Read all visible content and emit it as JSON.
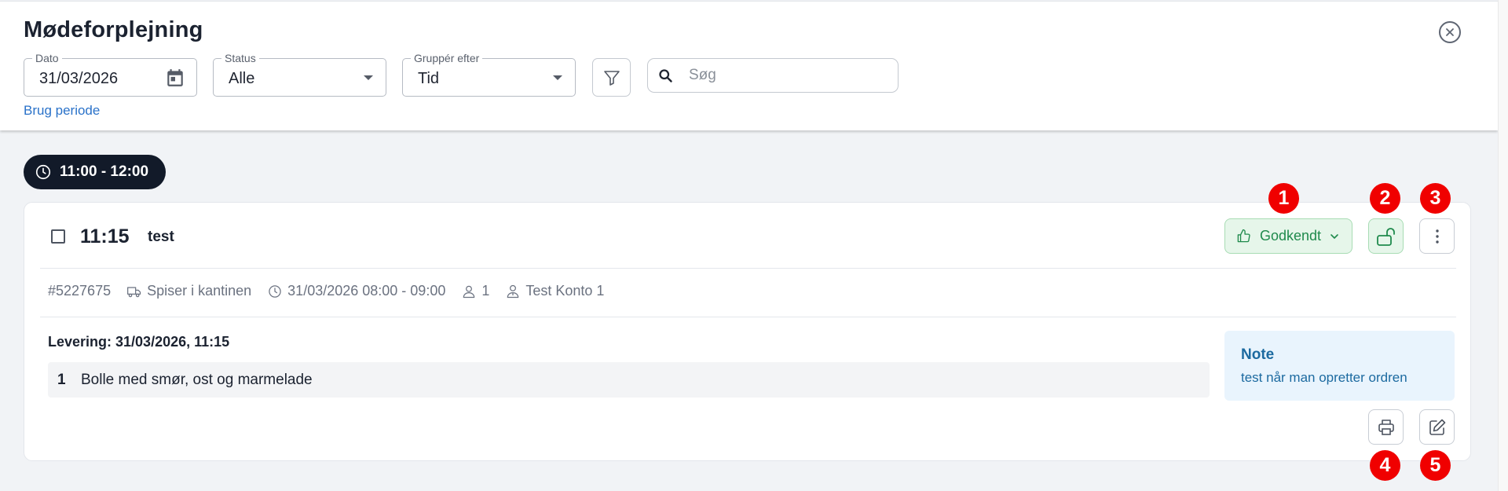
{
  "header": {
    "title": "Mødeforplejning",
    "date": {
      "label": "Dato",
      "value": "31/03/2026"
    },
    "status": {
      "label": "Status",
      "value": "Alle"
    },
    "group_by": {
      "label": "Gruppér efter",
      "value": "Tid"
    },
    "search": {
      "placeholder": "Søg"
    },
    "period_link": "Brug periode"
  },
  "time_group": {
    "label": "11:00 - 12:00"
  },
  "order": {
    "time": "11:15",
    "name": "test",
    "status_label": "Godkendt",
    "id": "#5227675",
    "location": "Spiser i kantinen",
    "datetime": "31/03/2026 08:00 - 09:00",
    "persons": "1",
    "account": "Test Konto 1",
    "delivery": "Levering: 31/03/2026, 11:15",
    "items": [
      {
        "qty": "1",
        "name": "Bolle med smør, ost og marmelade"
      }
    ],
    "note": {
      "title": "Note",
      "text": "test når man opretter ordren"
    }
  },
  "markers": [
    "1",
    "2",
    "3",
    "4",
    "5"
  ],
  "colors": {
    "approved_bg": "#e6f6ea",
    "approved_text": "#1f8a4c",
    "link": "#2a72c9",
    "note_text": "#1c6aa0",
    "pill_bg": "#121a29",
    "marker": "#f00000"
  },
  "icons": [
    "close-icon",
    "calendar-icon",
    "filter-icon",
    "search-icon",
    "clock-icon",
    "thumbs-up-icon",
    "chevron-down-icon",
    "unlock-icon",
    "more-vertical-icon",
    "truck-icon",
    "person-icon",
    "account-icon",
    "printer-icon",
    "edit-icon"
  ]
}
